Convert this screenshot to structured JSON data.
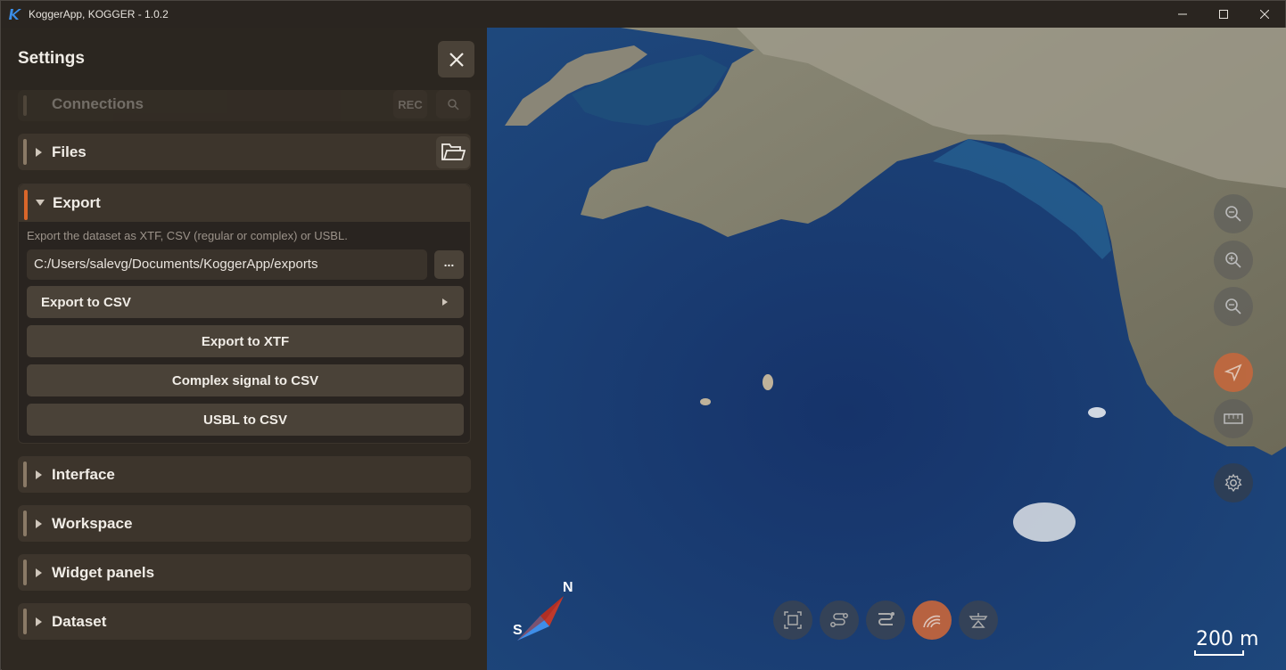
{
  "window": {
    "title": "KoggerApp, KOGGER - 1.0.2",
    "minimize_glyph": "—",
    "maximize_glyph": "☐",
    "close_glyph": "✕"
  },
  "settings": {
    "title": "Settings",
    "sections": {
      "connections": {
        "label": "Connections",
        "rec_label": "REC"
      },
      "files": {
        "label": "Files"
      },
      "export": {
        "label": "Export",
        "description": "Export the dataset as XTF, CSV (regular or complex) or USBL.",
        "path": "C:/Users/salevg/Documents/KoggerApp/exports",
        "browse_label": "...",
        "export_csv_label": "Export to CSV",
        "export_xtf_label": "Export to XTF",
        "complex_csv_label": "Complex signal to CSV",
        "usbl_csv_label": "USBL to CSV"
      },
      "interface": {
        "label": "Interface"
      },
      "workspace": {
        "label": "Workspace"
      },
      "widget_panels": {
        "label": "Widget panels"
      },
      "dataset": {
        "label": "Dataset"
      }
    }
  },
  "map": {
    "scale_label": "200 m",
    "compass_north": "N",
    "compass_south": "S",
    "tools": [
      "zoom-fit-icon",
      "zoom-in-icon",
      "zoom-out-icon",
      "navigate-icon",
      "ruler-icon",
      "settings-icon"
    ],
    "bottom_tools": [
      "frame-icon",
      "route-icon",
      "track-icon",
      "sonar-icon",
      "boat-icon"
    ],
    "active_color": "#c9673b"
  }
}
